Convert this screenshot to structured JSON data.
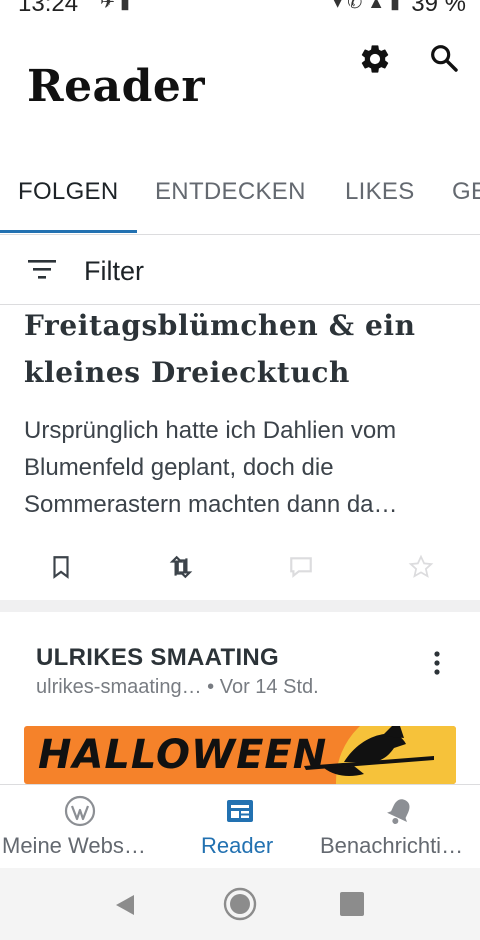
{
  "status_bar": {
    "time": "13:24",
    "battery": "39 %"
  },
  "header": {
    "title": "Reader"
  },
  "tabs": [
    {
      "label": "FOLGEN",
      "active": true
    },
    {
      "label": "ENTDECKEN",
      "active": false
    },
    {
      "label": "LIKES",
      "active": false
    },
    {
      "label": "GE",
      "active": false
    }
  ],
  "filter": {
    "label": "Filter"
  },
  "post": {
    "title": "Freitagsblümchen & ein kleines Dreiecktuch",
    "excerpt": "Ursprünglich hatte ich Dahlien vom Blumenfeld geplant, doch die Sommerastern machten dann da…"
  },
  "next_post": {
    "site_name": "ULRIKES SMAATING",
    "meta": "ulrikes-smaating… • Vor 14 Std.",
    "image_text": "HALLOWEEN"
  },
  "bottom_nav": [
    {
      "label": "Meine Webs…",
      "icon": "wordpress-icon",
      "active": false
    },
    {
      "label": "Reader",
      "icon": "reader-icon",
      "active": true
    },
    {
      "label": "Benachrichti…",
      "icon": "bell-icon",
      "active": false
    }
  ],
  "colors": {
    "accent": "#2271b1",
    "inactive": "#646970",
    "banner": "#f5822a"
  }
}
